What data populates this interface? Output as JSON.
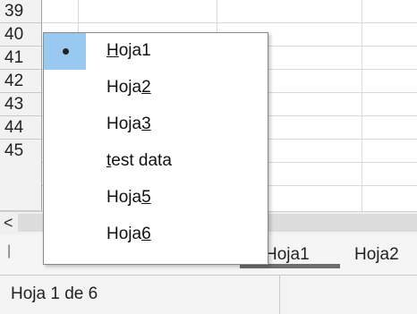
{
  "grid": {
    "row_numbers": [
      "39",
      "40",
      "41",
      "42",
      "43",
      "44",
      "45"
    ]
  },
  "scrollbar": {
    "left_arrow": "<"
  },
  "tabs": [
    {
      "label": "Hoja1",
      "active": true
    },
    {
      "label": "Hoja2",
      "active": false
    }
  ],
  "status": {
    "sheet_position": "Hoja 1 de 6"
  },
  "context_menu": {
    "items": [
      {
        "pre": "",
        "accel": "H",
        "post": "oja1",
        "checked": true
      },
      {
        "pre": "Hoja",
        "accel": "2",
        "post": "",
        "checked": false
      },
      {
        "pre": "Hoja",
        "accel": "3",
        "post": "",
        "checked": false
      },
      {
        "pre": "",
        "accel": "t",
        "post": "est data",
        "checked": false
      },
      {
        "pre": "Hoja",
        "accel": "5",
        "post": "",
        "checked": false
      },
      {
        "pre": "Hoja",
        "accel": "6",
        "post": "",
        "checked": false
      }
    ]
  },
  "colors": {
    "checked_highlight": "#99c9f0",
    "active_tab_underline": "#6e6e6e"
  }
}
